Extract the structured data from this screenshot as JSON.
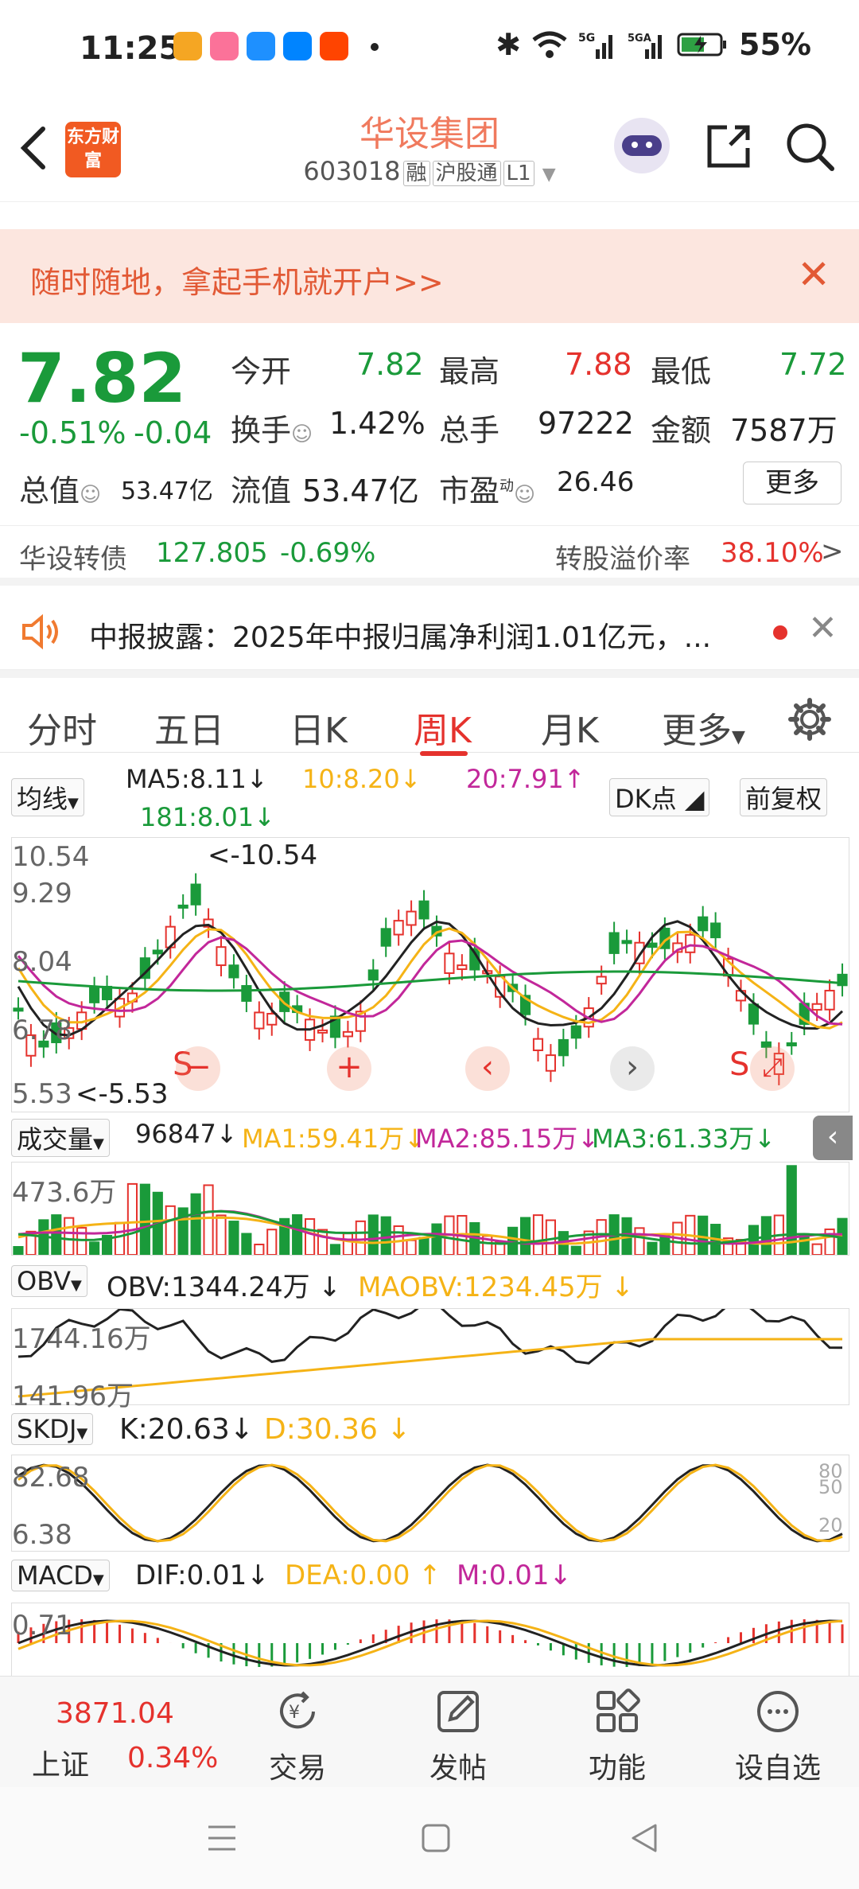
{
  "status": {
    "time": "11:25",
    "battery": "55%"
  },
  "header": {
    "logo_text": "东方财富",
    "stock_name": "华设集团",
    "stock_code": "603018",
    "tags": [
      "融",
      "沪股通",
      "L1"
    ]
  },
  "banner": {
    "text": "随时随地，拿起手机就开户>>"
  },
  "quote": {
    "price": "7.82",
    "change_pct": "-0.51%",
    "change_abs": "-0.04",
    "open_label": "今开",
    "open": "7.82",
    "high_label": "最高",
    "high": "7.88",
    "low_label": "最低",
    "low": "7.72",
    "turnover_label": "换手",
    "turnover": "1.42%",
    "volume_label": "总手",
    "volume": "97222",
    "amount_label": "金额",
    "amount": "7587万",
    "mcap_label": "总值",
    "mcap": "53.47亿",
    "float_label": "流值",
    "float": "53.47亿",
    "pe_label": "市盈",
    "pe_sup": "动",
    "pe": "26.46",
    "more_button": "更多"
  },
  "bond": {
    "name": "华设转债",
    "price": "127.805",
    "change": "-0.69%",
    "premium_label": "转股溢价率",
    "premium": "38.10%"
  },
  "notice": {
    "text": "中报披露：2025年中报归属净利润1.01亿元，..."
  },
  "period_tabs": [
    "分时",
    "五日",
    "日K",
    "周K",
    "月K",
    "更多"
  ],
  "active_tab": "周K",
  "ma_bar": {
    "selector": "均线",
    "ma5": "MA5:8.11",
    "ma10": "10:8.20",
    "ma20": "20:7.91",
    "ma181": "181:8.01",
    "dk": "DK点",
    "adjust": "前复权"
  },
  "kline": {
    "axis": [
      "10.54",
      "9.29",
      "8.04",
      "6.78",
      "5.53"
    ],
    "max_marker": "<-10.54",
    "min_marker": "<-5.53",
    "signal_s": "S"
  },
  "volume_panel": {
    "selector": "成交量",
    "value": "96847",
    "ma1": "MA1:59.41万",
    "ma2": "MA2:85.15万",
    "ma3": "MA3:61.33万",
    "axis_top": "473.6万"
  },
  "obv_panel": {
    "selector": "OBV",
    "obv": "OBV:1344.24万",
    "maobv": "MAOBV:1234.45万",
    "axis_top": "1744.16万",
    "axis_bottom": "141.96万"
  },
  "skdj_panel": {
    "selector": "SKDJ",
    "k": "K:20.63",
    "d": "D:30.36",
    "axis_top": "82.68",
    "axis_bottom": "6.38",
    "ref_80": "80",
    "ref_50": "50",
    "ref_20": "20"
  },
  "macd_panel": {
    "selector": "MACD",
    "dif": "DIF:0.01",
    "dea": "DEA:0.00",
    "m": "M:0.01",
    "axis_top": "0.71"
  },
  "bottom_bar": {
    "index_value": "3871.04",
    "index_name": "上证",
    "index_change": "0.34%",
    "items": [
      "交易",
      "发帖",
      "功能",
      "设自选"
    ]
  },
  "colors": {
    "up": "#e5322d",
    "down": "#1a9a3a",
    "brand": "#f15a22"
  }
}
